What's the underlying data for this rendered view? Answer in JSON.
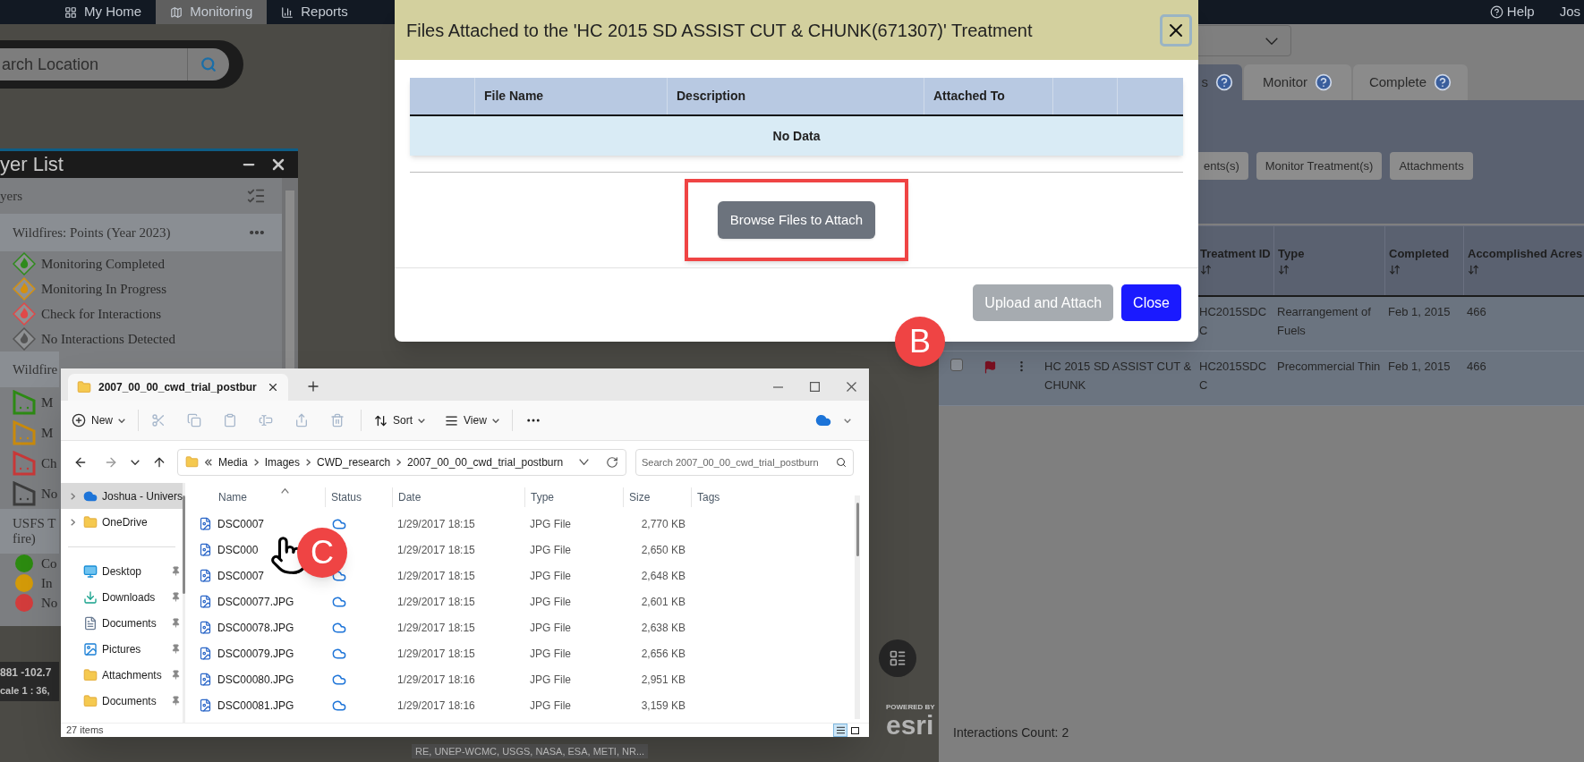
{
  "nav": {
    "items": [
      {
        "label": "My Home",
        "selected": false
      },
      {
        "label": "Monitoring",
        "selected": true
      },
      {
        "label": "Reports",
        "selected": false
      }
    ],
    "help": "Help",
    "user": "Jos"
  },
  "map": {
    "search": {
      "placeholder": "arch Location"
    },
    "coordinates": "881 -102.7",
    "scale": "cale 1 : 36,",
    "attribution": "RE, UNEP-WCMC, USGS, NASA, ESA, METI, NR...",
    "logo_caption": "POWERED BY",
    "logo": "esri"
  },
  "layer_list": {
    "title": "yer List",
    "subtitle": "yers",
    "groups": [
      {
        "name": "Wildfires: Points (Year 2023)",
        "has_menu": true,
        "legend": [
          {
            "kind": "flame",
            "label": "Monitoring Completed",
            "color": "#2f8a1c"
          },
          {
            "kind": "flame",
            "label": "Monitoring In Progress",
            "color": "#d4900f"
          },
          {
            "kind": "flame",
            "label": "Check for Interactions",
            "color": "#e04848"
          },
          {
            "kind": "flame",
            "label": "No Interactions Detected",
            "color": "#555555"
          }
        ]
      },
      {
        "name": "Wildfire",
        "has_menu": false,
        "legend": [
          {
            "kind": "polygon",
            "label": "M",
            "color": "#2d8a14"
          },
          {
            "kind": "polygon",
            "label": "M",
            "color": "#c98a0c"
          },
          {
            "kind": "polygon",
            "label": "Ch",
            "color": "#c83838"
          },
          {
            "kind": "polygon",
            "label": "No",
            "color": "#3c3c3c"
          }
        ]
      },
      {
        "name": "USFS T fire)",
        "has_menu": false,
        "legend": [
          {
            "kind": "dot",
            "label": "Co",
            "color": "#2c8a10"
          },
          {
            "kind": "dot",
            "label": "In",
            "color": "#d39a08"
          },
          {
            "kind": "dot",
            "label": "No",
            "color": "#d23c3c"
          }
        ]
      }
    ]
  },
  "right_panel": {
    "tabs": [
      {
        "label": "s",
        "selected": true
      },
      {
        "label": "Monitor",
        "selected": false
      },
      {
        "label": "Complete",
        "selected": false
      }
    ],
    "actions": [
      "ents(s)",
      "Monitor Treatment(s)",
      "Attachments"
    ],
    "table": {
      "columns": [
        "Treatment ID",
        "Type",
        "Completed",
        "Accomplished Acres"
      ],
      "rows": [
        {
          "treatment_id": "HC2015SDC C",
          "type": "Rearrangement of Fuels",
          "completed": "Feb 1, 2015",
          "acres": "466"
        },
        {
          "checked": false,
          "name": "HC 2015 SD ASSIST CUT & CHUNK",
          "treatment_id": "HC2015SDC C",
          "type": "Precommercial Thin",
          "completed": "Feb 1, 2015",
          "acres": "466"
        }
      ]
    },
    "interactions_count": "Interactions Count: 2"
  },
  "modal": {
    "title": "Files Attached to the 'HC 2015 SD ASSIST CUT & CHUNK(671307)' Treatment",
    "columns": [
      "File Name",
      "Description",
      "Attached To"
    ],
    "empty_text": "No Data",
    "browse_button": {
      "label": "Browse Files to Attach",
      "highlighted": true
    },
    "buttons": [
      {
        "label": "Upload and Attach",
        "kind": "secondary",
        "disabled": true
      },
      {
        "label": "Close",
        "kind": "primary",
        "disabled": false
      }
    ]
  },
  "explorer": {
    "tab_title": "2007_00_00_cwd_trial_postbur",
    "toolbar": {
      "new": "New",
      "sort": "Sort",
      "view": "View"
    },
    "breadcrumb": [
      "Media",
      "Images",
      "CWD_research",
      "2007_00_00_cwd_trial_postburn"
    ],
    "search_placeholder": "Search 2007_00_00_cwd_trial_postburn",
    "nav": [
      {
        "label": "Joshua - Univers",
        "kind": "cloud",
        "selected": true,
        "expandable": true,
        "pinned": false
      },
      {
        "label": "OneDrive",
        "kind": "folder",
        "selected": false,
        "expandable": true,
        "pinned": false
      },
      {
        "label": "Desktop",
        "kind": "desktop",
        "selected": false,
        "expandable": false,
        "pinned": true
      },
      {
        "label": "Downloads",
        "kind": "download",
        "selected": false,
        "expandable": false,
        "pinned": true
      },
      {
        "label": "Documents",
        "kind": "documents",
        "selected": false,
        "expandable": false,
        "pinned": true
      },
      {
        "label": "Pictures",
        "kind": "pictures",
        "selected": false,
        "expandable": false,
        "pinned": true
      },
      {
        "label": "Attachments",
        "kind": "folder",
        "selected": false,
        "expandable": false,
        "pinned": true
      },
      {
        "label": "Documents",
        "kind": "folder",
        "selected": false,
        "expandable": false,
        "pinned": true
      }
    ],
    "columns": [
      "Name",
      "Status",
      "Date",
      "Type",
      "Size",
      "Tags"
    ],
    "files": [
      {
        "name": "DSC0007",
        "cloud": true,
        "date": "1/29/2017 18:15",
        "type": "JPG File",
        "size": "2,770 KB"
      },
      {
        "name": "DSC000",
        "cloud": false,
        "date": "1/29/2017 18:15",
        "type": "JPG File",
        "size": "2,650 KB"
      },
      {
        "name": "DSC0007",
        "cloud": true,
        "date": "1/29/2017 18:15",
        "type": "JPG File",
        "size": "2,648 KB"
      },
      {
        "name": "DSC00077.JPG",
        "cloud": true,
        "date": "1/29/2017 18:15",
        "type": "JPG File",
        "size": "2,601 KB"
      },
      {
        "name": "DSC00078.JPG",
        "cloud": true,
        "date": "1/29/2017 18:15",
        "type": "JPG File",
        "size": "2,638 KB"
      },
      {
        "name": "DSC00079.JPG",
        "cloud": true,
        "date": "1/29/2017 18:15",
        "type": "JPG File",
        "size": "2,656 KB"
      },
      {
        "name": "DSC00080.JPG",
        "cloud": true,
        "date": "1/29/2017 18:16",
        "type": "JPG File",
        "size": "2,951 KB"
      },
      {
        "name": "DSC00081.JPG",
        "cloud": true,
        "date": "1/29/2017 18:16",
        "type": "JPG File",
        "size": "3,159 KB"
      }
    ],
    "item_count": "27 items",
    "view_buttons": [
      {
        "kind": "details",
        "selected": true
      },
      {
        "kind": "tiles",
        "selected": false
      }
    ]
  },
  "callouts": [
    {
      "label": "B"
    },
    {
      "label": "C"
    }
  ]
}
